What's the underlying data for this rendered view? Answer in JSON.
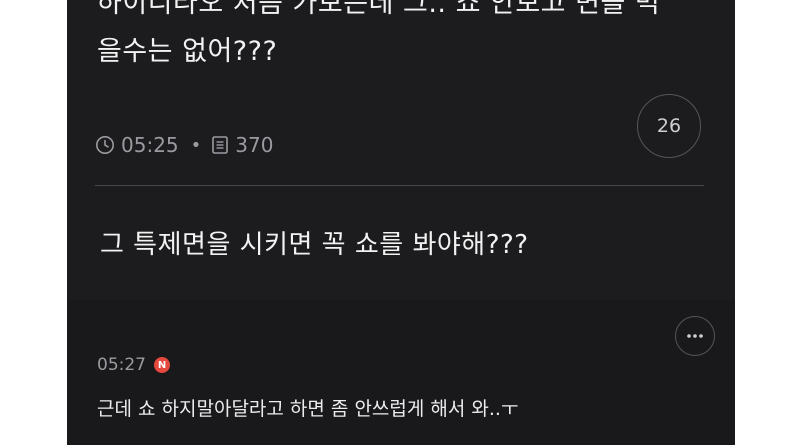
{
  "post": {
    "body_line1": "하이디라오 처음 가보는데 그.. 쇼 안보고 면을 먹",
    "body_line2": "을수는 없어???",
    "time": "05:25",
    "views": "370",
    "comment_count": "26",
    "icons": [
      "clock-icon",
      "document-icon"
    ]
  },
  "next_post": {
    "title": "그 특제면을 시키면 꼭 쇼를 봐야해???"
  },
  "reply": {
    "time": "05:27",
    "new_badge": "N",
    "text": "근데 쇼 하지말아달라고 하면 좀 안쓰럽게 해서 와..ㅜ",
    "more_icon": "more-horizontal-icon"
  },
  "colors": {
    "background": "#1c1c1e",
    "badge": "#e5483d",
    "meta_text": "#9a9aa0"
  }
}
